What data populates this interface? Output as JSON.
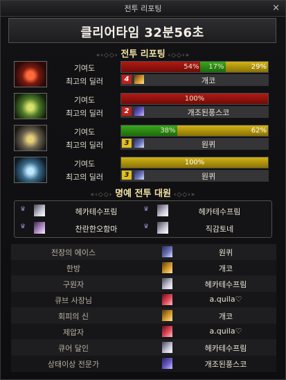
{
  "window": {
    "title": "전투 리포팅",
    "close_label": "×"
  },
  "clear_time": "클리어타임  32분56초",
  "section_report": "전투 리포팅",
  "section_honor": "명예 전투 대원",
  "row_labels": {
    "contribution": "기여도",
    "best_dealer": "최고의 딜러"
  },
  "members": [
    {
      "portrait": "fire-character-portrait",
      "segments": [
        {
          "color": "#b01a14",
          "pct": 54,
          "label": "54%"
        },
        {
          "color": "#3aa61e",
          "pct": 17,
          "label": "17%"
        },
        {
          "color": "#d2b418",
          "pct": 29,
          "label": "29%"
        }
      ],
      "rank": "4",
      "dealer": "개코"
    },
    {
      "portrait": "green-character-portrait",
      "segments": [
        {
          "color": "#b01a14",
          "pct": 100,
          "label": "100%"
        }
      ],
      "rank": "2",
      "dealer": "개조된풍스코"
    },
    {
      "portrait": "gold-character-portrait",
      "segments": [
        {
          "color": "#3aa61e",
          "pct": 38,
          "label": "38%"
        },
        {
          "color": "#d2b418",
          "pct": 62,
          "label": "62%"
        }
      ],
      "rank": "3",
      "dealer": "원퀴"
    },
    {
      "portrait": "blue-character-portrait",
      "segments": [
        {
          "color": "#d2b418",
          "pct": 100,
          "label": "100%"
        }
      ],
      "rank": "3",
      "dealer": "원퀴"
    }
  ],
  "honor": [
    {
      "name": "헤카테수프림"
    },
    {
      "name": "헤카테수프림"
    },
    {
      "name": "찬란한오함마"
    },
    {
      "name": "직감토네"
    }
  ],
  "titles": [
    {
      "label": "전장의 에이스",
      "name": "원퀴"
    },
    {
      "label": "한방",
      "name": "개코"
    },
    {
      "label": "구원자",
      "name": "헤카테수프림"
    },
    {
      "label": "큐브 사장님",
      "name": "a.quila♡"
    },
    {
      "label": "회피의 신",
      "name": "개코"
    },
    {
      "label": "제압자",
      "name": "a.quila♡"
    },
    {
      "label": "큐어 달인",
      "name": "헤카테수프림"
    },
    {
      "label": "상태이상 전문가",
      "name": "개조된풍스코"
    }
  ]
}
